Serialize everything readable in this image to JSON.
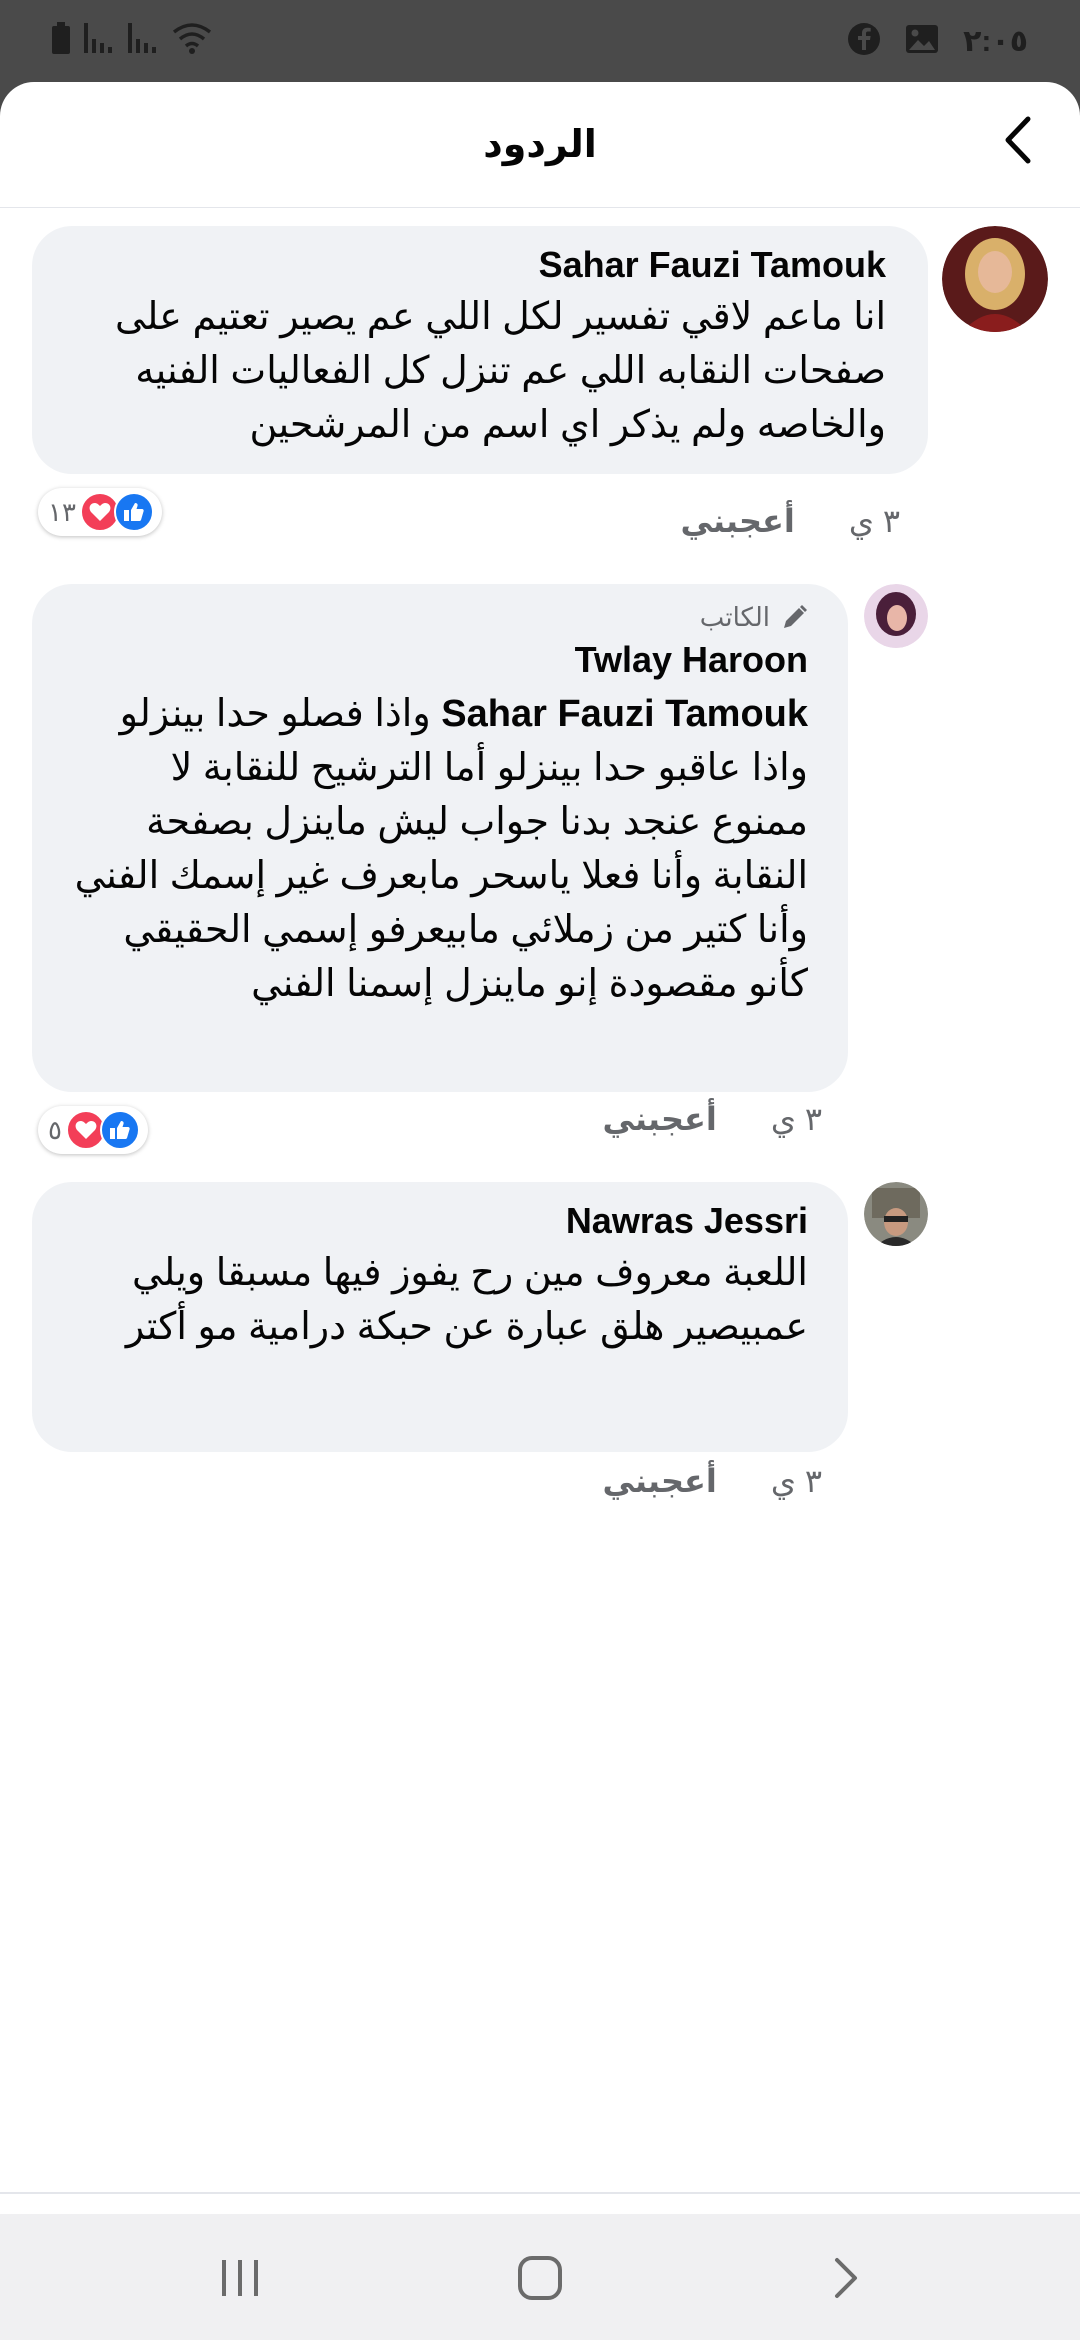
{
  "status_bar": {
    "time": "٢:٠٥",
    "icons": [
      "battery-icon",
      "signal-icon",
      "signal-icon",
      "wifi-icon",
      "facebook-icon",
      "gallery-icon"
    ]
  },
  "header": {
    "title": "الردود",
    "back_icon": "chevron-left-icon"
  },
  "comments": [
    {
      "author": "Sahar Fauzi Tamouk",
      "badge": "",
      "mention": "",
      "text": "انا ماعم لاقي تفسير لكل اللي عم يصير تعتيم على صفحات النقابه اللي عم تنزل كل الفعاليات الفنيه والخاصه ولم يذكر اي اسم من المرشحين",
      "time": "٣ ي",
      "like_label": "أعجبني",
      "reaction_count": "١٣",
      "reactions": [
        "like",
        "love"
      ]
    },
    {
      "author": "Twlay Haroon",
      "badge": "الكاتب",
      "mention": "Sahar Fauzi Tamouk",
      "text": "واذا فصلو حدا بينزلو واذا عاقبو حدا بينزلو أما الترشيح للنقابة لا ممنوع عنجد بدنا جواب ليش ماينزل بصفحة النقابة وأنا فعلا ياسحر مابعرف غير إسمك الفني وأنا كتير من زملائي مابيعرفو إسمي الحقيقي كأنو مقصودة إنو ماينزل إسمنا الفني",
      "time": "٣ ي",
      "like_label": "أعجبني",
      "reaction_count": "٥",
      "reactions": [
        "like",
        "love"
      ]
    },
    {
      "author": "Nawras Jessri",
      "badge": "",
      "mention": "",
      "text": "اللعبة معروف مين رح يفوز فيها مسبقا ويلي عمبيصير هلق عبارة عن حبكة درامية مو أكتر",
      "time": "٣ ي",
      "like_label": "أعجبني",
      "reaction_count": "",
      "reactions": []
    }
  ],
  "nav_bar": {
    "icons": [
      "recent-apps-icon",
      "home-icon",
      "back-icon"
    ]
  },
  "colors": {
    "bubble": "#f0f2f5",
    "like_blue": "#1877f2",
    "love_red": "#f33e58",
    "secondary_text": "#65676b"
  }
}
